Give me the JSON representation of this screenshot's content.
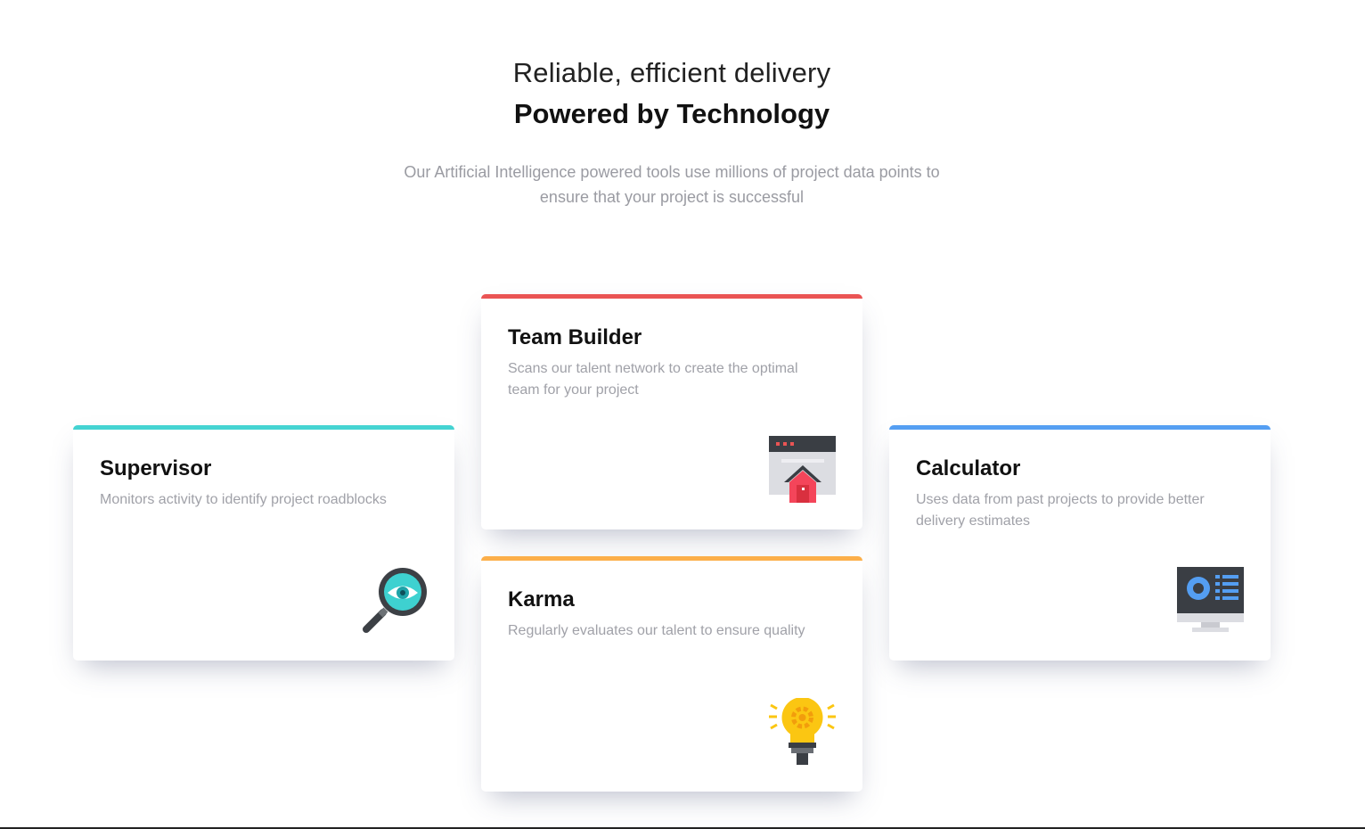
{
  "header": {
    "tagline": "Reliable, efficient delivery",
    "heading": "Powered by Technology",
    "description": "Our Artificial Intelligence powered tools use millions of project data points to ensure that your project is successful"
  },
  "cards": [
    {
      "title": "Supervisor",
      "description": "Monitors activity to identify project roadblocks",
      "icon": "magnifier-eye-icon",
      "accent": "#44d3d2"
    },
    {
      "title": "Team Builder",
      "description": "Scans our talent network to create the optimal team for your project",
      "icon": "browser-house-icon",
      "accent": "#ea5454"
    },
    {
      "title": "Karma",
      "description": "Regularly evaluates our talent to ensure quality",
      "icon": "lightbulb-icon",
      "accent": "#fcaf4a"
    },
    {
      "title": "Calculator",
      "description": "Uses data from past projects to provide better delivery estimates",
      "icon": "computer-monitor-icon",
      "accent": "#549ef2"
    }
  ]
}
